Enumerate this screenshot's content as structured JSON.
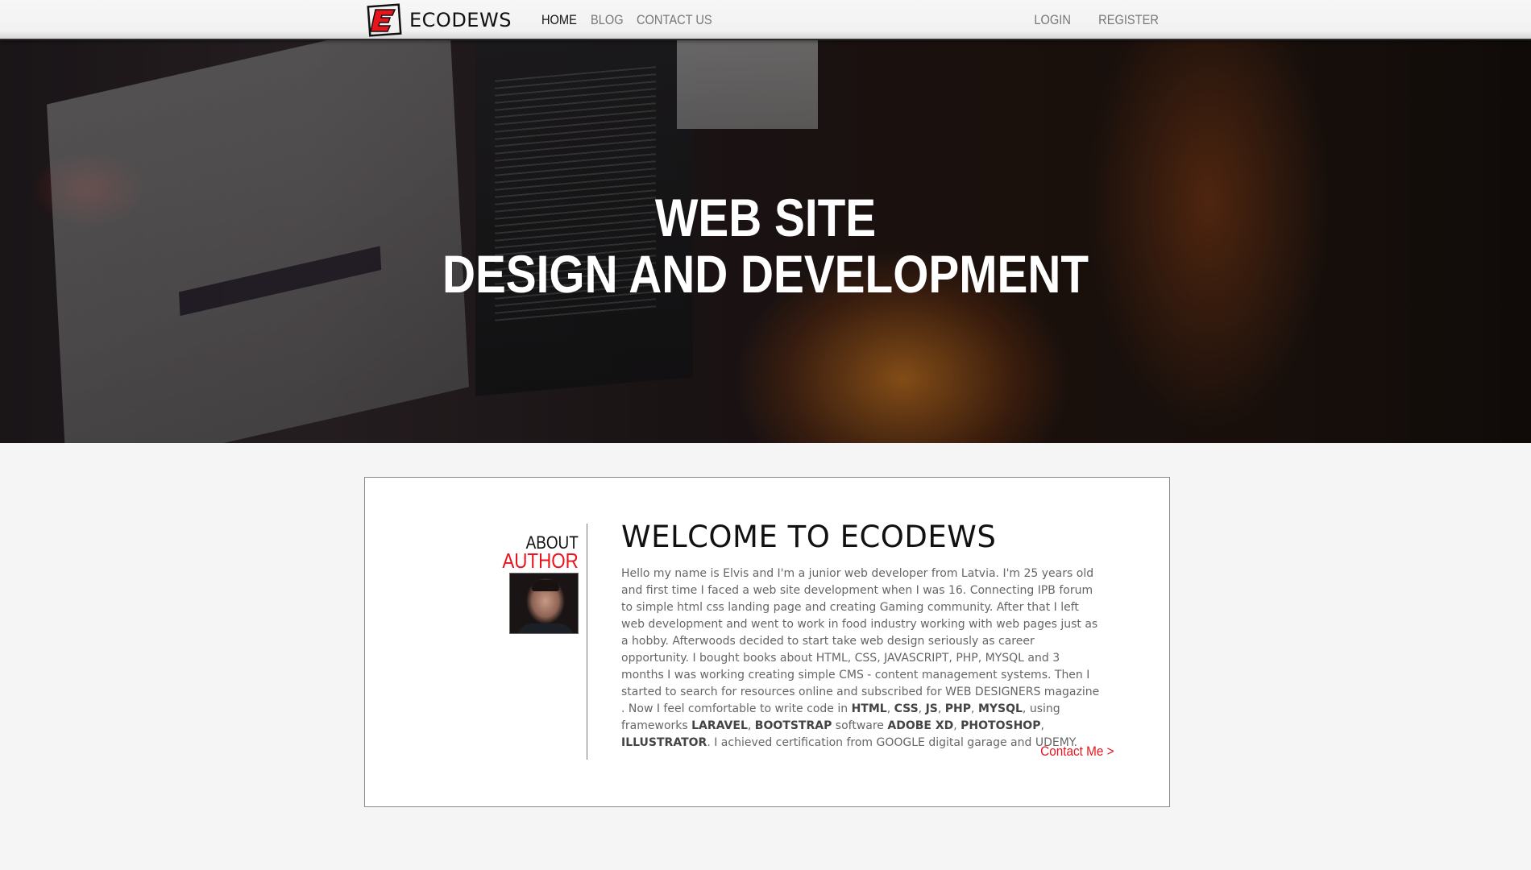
{
  "brand": {
    "name": "ECODEWS",
    "logo_letter": "E"
  },
  "nav": {
    "left": [
      {
        "label": "HOME",
        "active": true
      },
      {
        "label": "BLOG",
        "active": false
      },
      {
        "label": "CONTACT US",
        "active": false
      }
    ],
    "right": [
      {
        "label": "LOGIN"
      },
      {
        "label": "REGISTER"
      }
    ]
  },
  "hero": {
    "line1": "WEB SITE",
    "line2": "DESIGN AND DEVELOPMENT"
  },
  "about": {
    "line1": "ABOUT",
    "line2": "AUTHOR"
  },
  "welcome": {
    "title": "WELCOME TO ECODEWS",
    "bio": [
      {
        "text": "Hello my name is Elvis and I'm a junior web developer from Latvia. I'm 25 years old and first time I faced a web site development when I was 16. Connecting IPB forum to simple html css landing page and creating Gaming community. After that I left web development and went to work in food industry working with web pages just as a hobby. Afterwoods decided to start take web design seriously as career opportunity. I bought books about HTML, CSS, JAVASCRIPT, PHP, MYSQL and 3 months I was working creating simple CMS - content management systems. Then I started to search for resources online and subscribed for WEB DESIGNERS magazine . Now I feel comfortable to write code in ",
        "bold": false
      },
      {
        "text": "HTML",
        "bold": true
      },
      {
        "text": ", ",
        "bold": false
      },
      {
        "text": "CSS",
        "bold": true
      },
      {
        "text": ", ",
        "bold": false
      },
      {
        "text": "JS",
        "bold": true
      },
      {
        "text": ", ",
        "bold": false
      },
      {
        "text": "PHP",
        "bold": true
      },
      {
        "text": ", ",
        "bold": false
      },
      {
        "text": "MYSQL",
        "bold": true
      },
      {
        "text": ", using frameworks ",
        "bold": false
      },
      {
        "text": "LARAVEL",
        "bold": true
      },
      {
        "text": ", ",
        "bold": false
      },
      {
        "text": "BOOTSTRAP",
        "bold": true
      },
      {
        "text": " software ",
        "bold": false
      },
      {
        "text": "ADOBE XD",
        "bold": true
      },
      {
        "text": ", ",
        "bold": false
      },
      {
        "text": "PHOTOSHOP",
        "bold": true
      },
      {
        "text": ", ",
        "bold": false
      },
      {
        "text": "ILLUSTRATOR",
        "bold": true
      },
      {
        "text": ". I achieved certification from GOOGLE digital garage and UDEMY.",
        "bold": false
      }
    ],
    "contact_label": "Contact Me >"
  },
  "colors": {
    "accent": "#e8141b",
    "text_dark": "#111111",
    "text_muted": "#666666",
    "page_bg": "#f5f5f5"
  }
}
